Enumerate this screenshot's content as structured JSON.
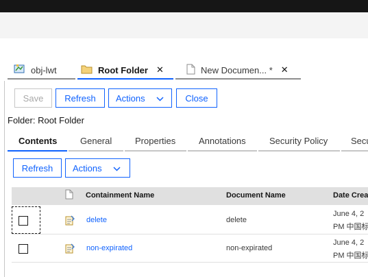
{
  "tabs": [
    {
      "label": "obj-lwt",
      "icon": "object-icon",
      "closable": false,
      "active": false
    },
    {
      "label": "Root Folder",
      "icon": "folder-icon",
      "closable": true,
      "active": true
    },
    {
      "label": "New Documen... *",
      "icon": "document-icon",
      "closable": true,
      "active": false
    }
  ],
  "tab_close_glyph": "✕",
  "toolbar": {
    "save": "Save",
    "refresh": "Refresh",
    "actions": "Actions",
    "close": "Close"
  },
  "folder_label": "Folder: Root Folder",
  "inner_tabs": [
    "Contents",
    "General",
    "Properties",
    "Annotations",
    "Security Policy",
    "Secu"
  ],
  "sub_toolbar": {
    "refresh": "Refresh",
    "actions": "Actions"
  },
  "table": {
    "headers": [
      "Containment Name",
      "Document Name",
      "Date Crea"
    ],
    "rows": [
      {
        "containment": "delete",
        "document": "delete",
        "date_line1": "June 4, 2",
        "date_line2": "PM 中国标"
      },
      {
        "containment": "non-expirated",
        "document": "non-expirated",
        "date_line1": "June 4, 2",
        "date_line2": "PM 中国标"
      }
    ]
  },
  "colors": {
    "accent": "#0f62fe",
    "tab_active_underline": "#0f62fe",
    "tab_inactive_underline": "#8d8d8d"
  }
}
